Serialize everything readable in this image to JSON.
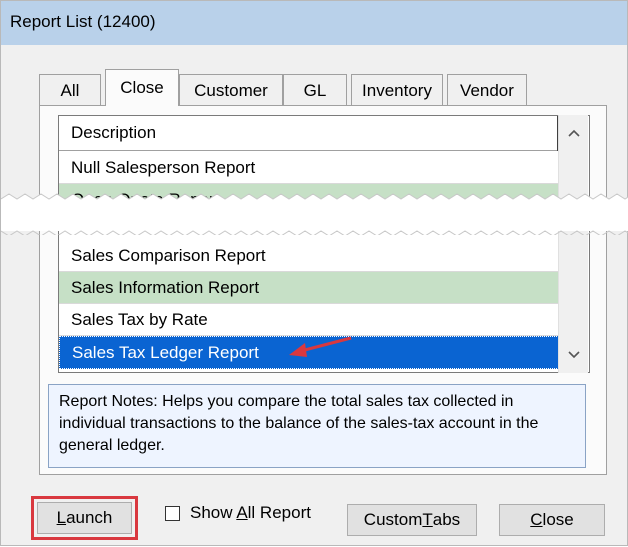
{
  "window": {
    "title": "Report List (12400)"
  },
  "tabs": [
    {
      "label": "All",
      "active": false
    },
    {
      "label": "Close",
      "active": true
    },
    {
      "label": "Customer",
      "active": false
    },
    {
      "label": "GL",
      "active": false
    },
    {
      "label": "Inventory",
      "active": false
    },
    {
      "label": "Vendor",
      "active": false
    }
  ],
  "list": {
    "header": "Description",
    "top_rows": [
      "Null Salesperson Report",
      "Open Quote Report"
    ],
    "bottom_rows": [
      "Sales Comparison Report",
      "Sales Information Report",
      "Sales Tax by Rate",
      "Sales Tax Ledger Report"
    ],
    "selected": "Sales Tax Ledger Report"
  },
  "notes": {
    "text": "Report Notes:  Helps you compare the total sales tax collected in individual transactions to the balance of the sales-tax account in the general ledger."
  },
  "buttons": {
    "launch": {
      "prefix": "",
      "accel": "L",
      "rest": "aunch"
    },
    "custom_tabs": {
      "prefix": "Custom ",
      "accel": "T",
      "rest": "abs"
    },
    "close": {
      "prefix": "",
      "accel": "C",
      "rest": "lose"
    }
  },
  "checkbox": {
    "prefix": "Show ",
    "accel": "A",
    "rest": "ll Report",
    "checked": false
  },
  "colors": {
    "accent_selected": "#0a64d2",
    "row_alt": "#c6e0c6",
    "highlight": "#d9383f"
  },
  "icons": {
    "scroll_up": "▲",
    "scroll_down": "▼"
  }
}
